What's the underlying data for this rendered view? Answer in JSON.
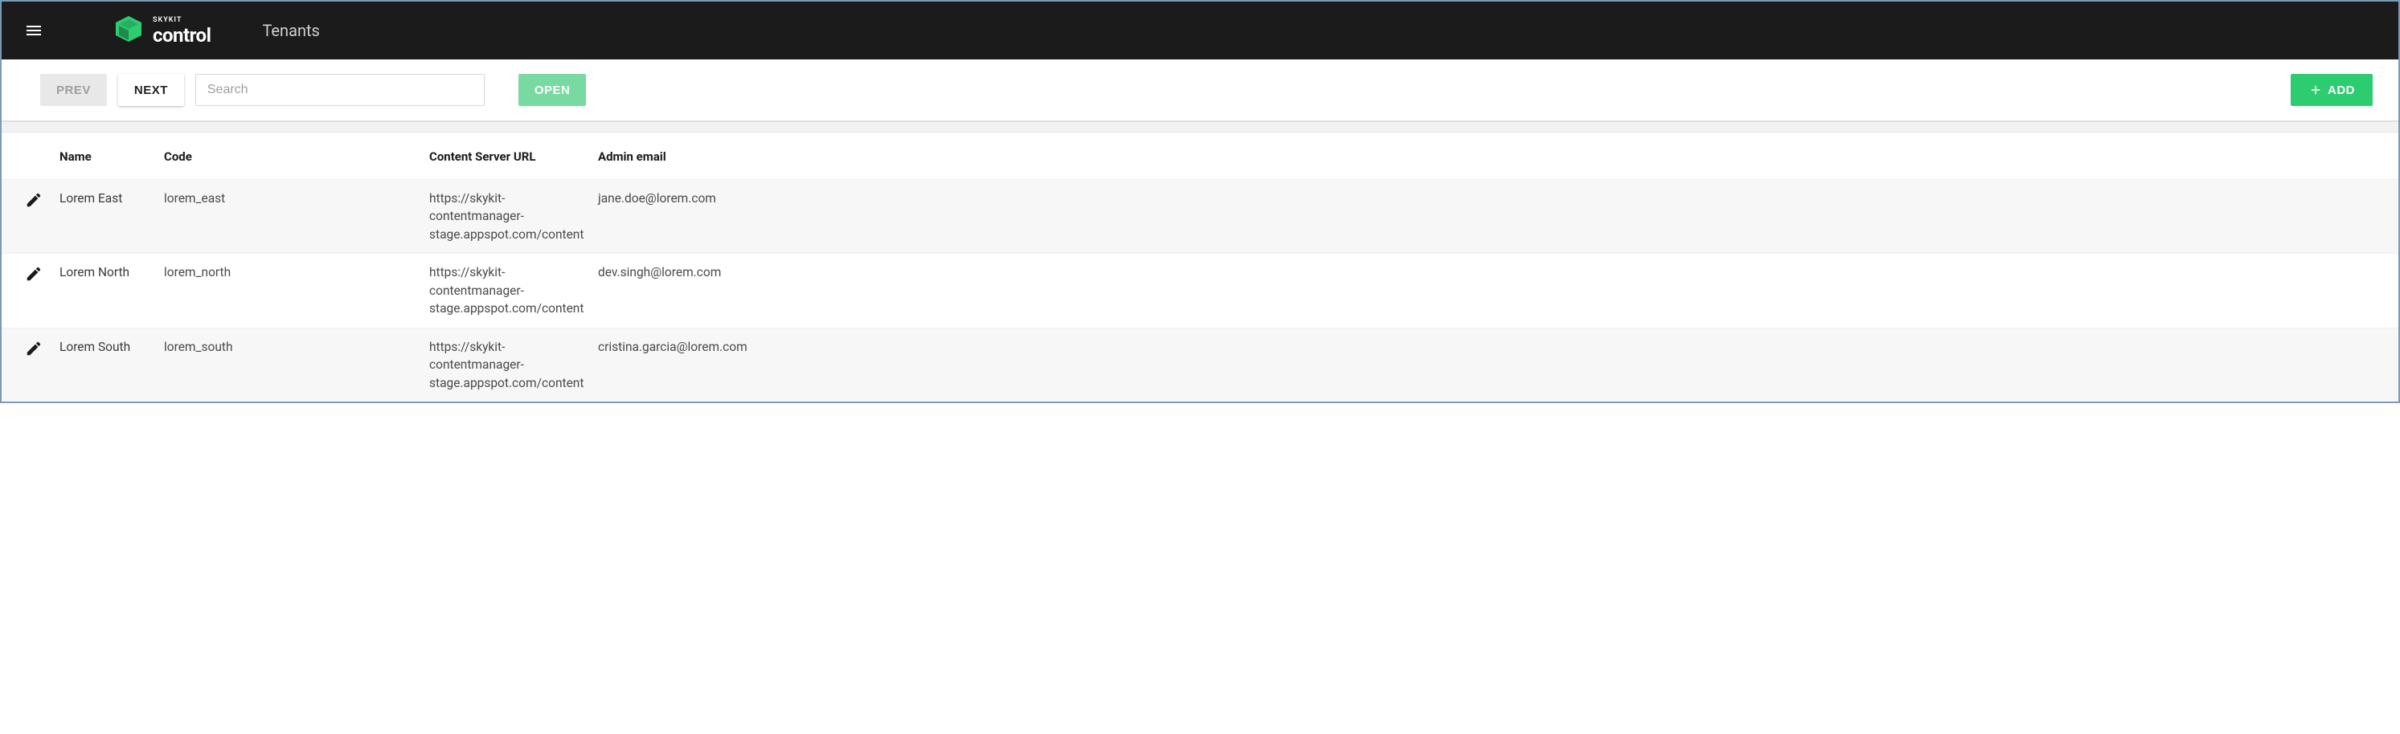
{
  "header": {
    "brand_small": "SKYKIT",
    "brand_large": "control",
    "page_title": "Tenants"
  },
  "toolbar": {
    "prev_label": "PREV",
    "next_label": "NEXT",
    "search_placeholder": "Search",
    "open_label": "OPEN",
    "add_label": "ADD"
  },
  "table": {
    "headers": {
      "name": "Name",
      "code": "Code",
      "url": "Content Server URL",
      "email": "Admin email"
    },
    "rows": [
      {
        "name": "Lorem East",
        "code": "lorem_east",
        "url": "https://skykit-contentmanager-stage.appspot.com/content",
        "email": "jane.doe@lorem.com"
      },
      {
        "name": "Lorem North",
        "code": "lorem_north",
        "url": "https://skykit-contentmanager-stage.appspot.com/content",
        "email": "dev.singh@lorem.com"
      },
      {
        "name": "Lorem South",
        "code": "lorem_south",
        "url": "https://skykit-contentmanager-stage.appspot.com/content",
        "email": "cristina.garcia@lorem.com"
      }
    ]
  }
}
